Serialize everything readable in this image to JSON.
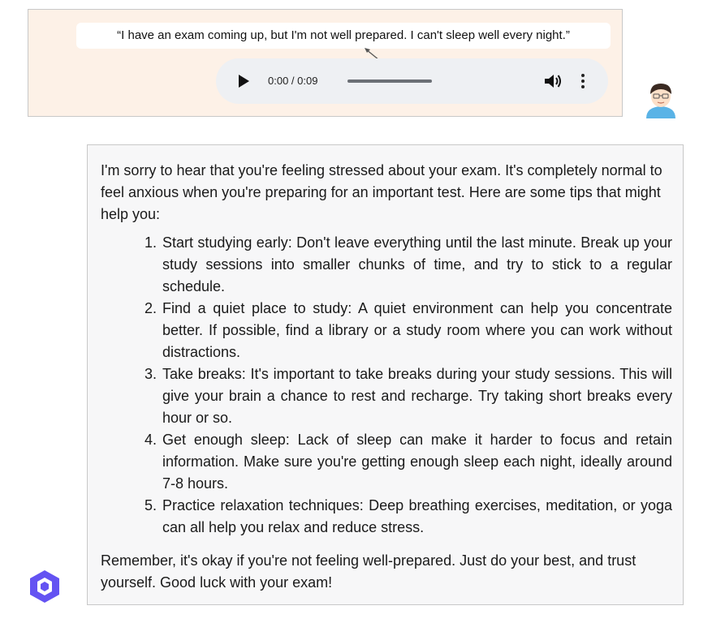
{
  "user_message": {
    "quote": "“I have an exam coming up, but I'm not well prepared. I can't sleep well every night.”",
    "audio": {
      "time": "0:00 / 0:09",
      "play_icon": "play-icon",
      "volume_icon": "volume-icon",
      "menu_icon": "more-vertical-icon"
    },
    "avatar": "user-avatar-icon"
  },
  "assistant_message": {
    "intro": "I'm sorry to hear that you're feeling stressed about your exam. It's completely normal to feel anxious when you're preparing for an important test. Here are some tips that might help you:",
    "tips": [
      {
        "num": "1.",
        "text": "Start studying early: Don't leave everything until the last minute. Break up your study sessions into smaller chunks of time, and try to stick to a regular schedule."
      },
      {
        "num": "2.",
        "text": "Find a quiet place to study: A quiet environment can help you concentrate better. If possible, find a library or a study room where you can work without distractions."
      },
      {
        "num": "3.",
        "text": "Take breaks: It's important to take breaks during your study sessions. This will give your brain a chance to rest and recharge. Try taking short breaks every hour or so."
      },
      {
        "num": "4.",
        "text": "Get enough sleep: Lack of sleep can make it harder to focus and retain information. Make sure you're getting enough sleep each night, ideally around 7-8 hours."
      },
      {
        "num": "5.",
        "text": "Practice relaxation techniques: Deep breathing exercises, meditation, or yoga can all help you relax and reduce stress."
      }
    ],
    "outro": "Remember, it's okay if you're not feeling well-prepared. Just do your best, and trust yourself. Good luck with your exam!",
    "logo": "qwen-logo-icon"
  },
  "colors": {
    "user_bg": "#fdf1e7",
    "reply_bg": "#f7f7f8",
    "player_bg": "#eef0f3",
    "logo": "#6453f2"
  }
}
